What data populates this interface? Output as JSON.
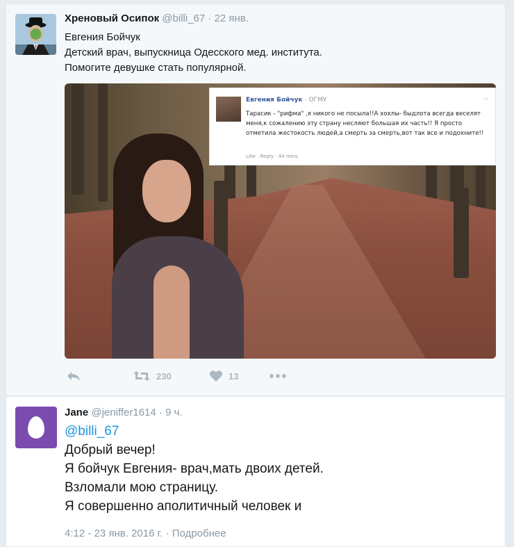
{
  "tweet": {
    "author_name": "Хреновый Осипок",
    "author_handle": "@billi_67",
    "separator": "·",
    "time": "22 янв.",
    "lines": [
      "Евгения Бойчук",
      "Детский врач, выпускница Одесского мед. института.",
      "Помогите девушке стать популярной."
    ],
    "embedded_post": {
      "name": "Евгения Бойчук",
      "sub": "· ОГМУ",
      "text": "Тарасик - \"рифма\" ,я никого не посыла!!А хохлы- быдлота всегда веселят меня,к сожалению эту страну несляют большая их часть!! Я просто отметила жестокость людей,а смерть за смерть,вот так все и подохните!!",
      "meta": "Like · Reply · 44 mins"
    },
    "actions": {
      "retweet_count": "230",
      "like_count": "13"
    },
    "icons": [
      "reply-icon",
      "retweet-icon",
      "heart-icon",
      "more-icon"
    ]
  },
  "reply": {
    "author_name": "Jane",
    "author_handle": "@jeniffer1614",
    "separator": "·",
    "time": "9 ч.",
    "mention": "@billi_67",
    "lines": [
      "Добрый вечер!",
      "Я бойчук Евгения- врач,мать двоих детей.",
      "Взломали мою страницу.",
      "Я совершенно аполитичный человек и"
    ],
    "footer": "4:12 - 23 янв. 2016 г. · Подробнее"
  },
  "colors": {
    "link": "#1b95e0",
    "muted": "#8899a6",
    "egg_bg": "#7b4bb0"
  }
}
